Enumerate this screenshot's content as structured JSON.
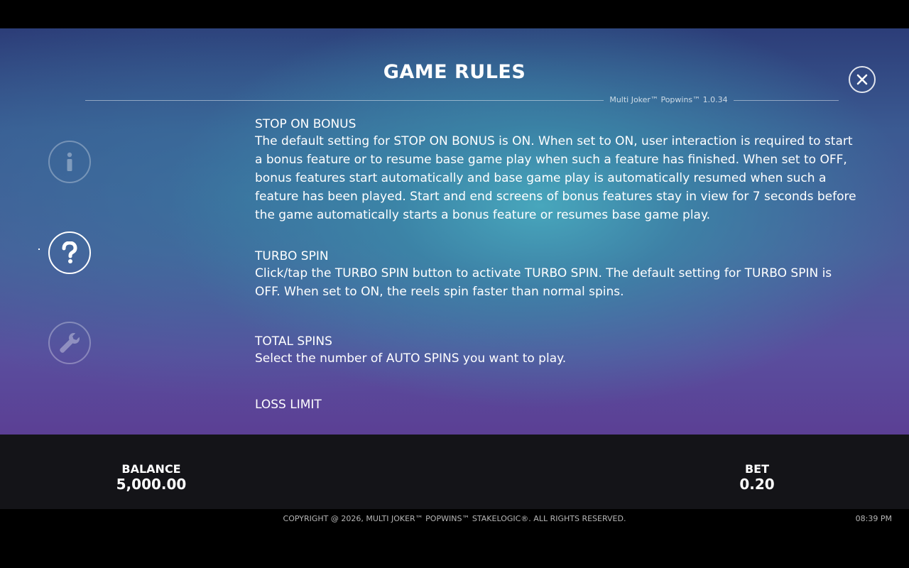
{
  "header": {
    "title": "GAME RULES",
    "version": "Multi Joker™ Popwins™ 1.0.34",
    "close_label": "X"
  },
  "sidebar": {
    "items": [
      {
        "name": "info",
        "icon": "info-icon",
        "active": false
      },
      {
        "name": "help",
        "icon": "question-icon",
        "active": true
      },
      {
        "name": "settings",
        "icon": "wrench-icon",
        "active": false
      }
    ]
  },
  "rules": {
    "sections": [
      {
        "title": "STOP ON BONUS",
        "body": "The default setting for STOP ON BONUS is ON. When set to ON, user interaction is required to start a bonus feature or to resume base game play when such a feature has finished. When set to OFF, bonus features start automatically and base game play is automatically resumed when such a feature has been played. Start and end screens of bonus features stay in view for 7 seconds before the game automatically starts a bonus feature or resumes base game play."
      },
      {
        "title": "TURBO SPIN",
        "body": "Click/tap the TURBO SPIN button to activate TURBO SPIN. The default setting for TURBO SPIN is OFF. When set to ON, the reels spin faster than normal spins."
      },
      {
        "title": "TOTAL SPINS",
        "body": "Select the number of AUTO SPINS you want to play."
      },
      {
        "title": "LOSS LIMIT",
        "body": ""
      }
    ]
  },
  "status": {
    "balance_label": "BALANCE",
    "balance_value": "5,000.00",
    "bet_label": "BET",
    "bet_value": "0.20"
  },
  "footer": {
    "copyright": "COPYRIGHT @ 2026, MULTI JOKER™ POPWINS™ STAKELOGIC®. ALL RIGHTS RESERVED.",
    "time": "08:39 PM"
  }
}
